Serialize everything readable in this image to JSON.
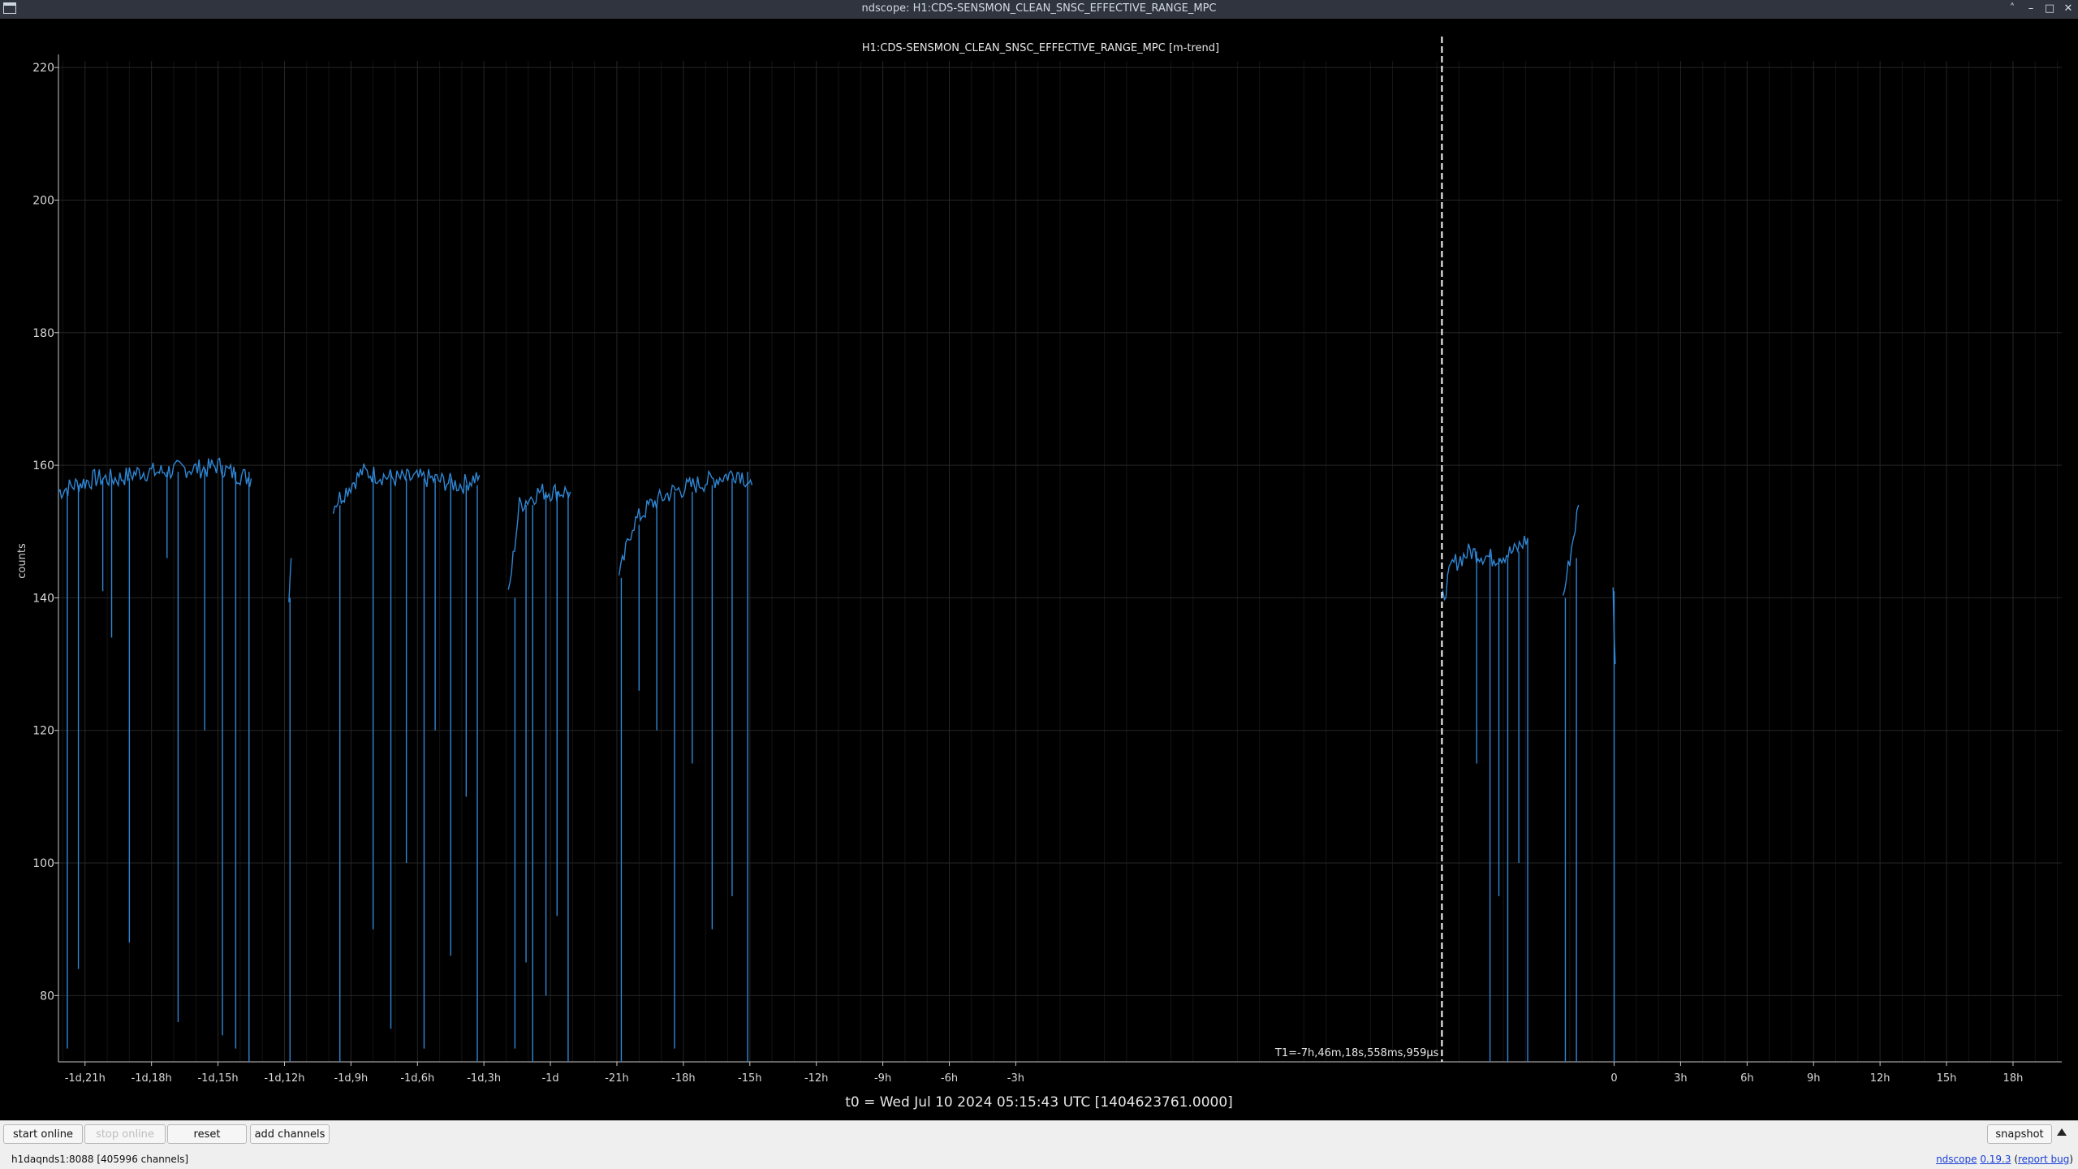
{
  "window": {
    "title": "ndscope: H1:CDS-SENSMON_CLEAN_SNSC_EFFECTIVE_RANGE_MPC",
    "controls": [
      "˄",
      "–",
      "□",
      "✕"
    ]
  },
  "plot": {
    "title": "H1:CDS-SENSMON_CLEAN_SNSC_EFFECTIVE_RANGE_MPC [m-trend]",
    "ylabel": "counts",
    "cursor_label": "T1=-7h,46m,18s,558ms,959μs",
    "t0_label": "t0 = Wed Jul 10 2024 05:15:43 UTC [1404623761.0000]"
  },
  "chart_data": {
    "type": "line",
    "title": "H1:CDS-SENSMON_CLEAN_SNSC_EFFECTIVE_RANGE_MPC [m-trend]",
    "xlabel": "t0 = Wed Jul 10 2024 05:15:43 UTC [1404623761.0000]",
    "ylabel": "counts",
    "xlim": [
      -70.2,
      20.2
    ],
    "ylim": [
      70,
      221
    ],
    "y_ticks": [
      80,
      100,
      120,
      140,
      160,
      180,
      200,
      220
    ],
    "x_ticks": [
      {
        "v": -69,
        "label": "-1d,21h"
      },
      {
        "v": -66,
        "label": "-1d,18h"
      },
      {
        "v": -63,
        "label": "-1d,15h"
      },
      {
        "v": -60,
        "label": "-1d,12h"
      },
      {
        "v": -57,
        "label": "-1d,9h"
      },
      {
        "v": -54,
        "label": "-1d,6h"
      },
      {
        "v": -51,
        "label": "-1d,3h"
      },
      {
        "v": -48,
        "label": "-1d"
      },
      {
        "v": -45,
        "label": "-21h"
      },
      {
        "v": -42,
        "label": "-18h"
      },
      {
        "v": -39,
        "label": "-15h"
      },
      {
        "v": -36,
        "label": "-12h"
      },
      {
        "v": -33,
        "label": "-9h"
      },
      {
        "v": -30,
        "label": "-6h"
      },
      {
        "v": -27,
        "label": "-3h"
      },
      {
        "v": 0,
        "label": "0"
      },
      {
        "v": 3,
        "label": "3h"
      },
      {
        "v": 6,
        "label": "6h"
      },
      {
        "v": 9,
        "label": "9h"
      },
      {
        "v": 12,
        "label": "12h"
      },
      {
        "v": 15,
        "label": "15h"
      },
      {
        "v": 18,
        "label": "18h"
      }
    ],
    "grid": true,
    "cursor_x": -7.77,
    "line_color": "#2f86d4",
    "series": [
      {
        "segments": [
          {
            "x": [
              -70.2,
              -69.5,
              -68.5,
              -67.5,
              -66.5,
              -65.5,
              -64.5,
              -63.5,
              -63,
              -62.5,
              -61.5
            ],
            "y": [
              156,
              157,
              158,
              158,
              159,
              159,
              159.5,
              159.5,
              160,
              159,
              158
            ],
            "dips": [
              [
                -69.8,
                72
              ],
              [
                -69.3,
                84
              ],
              [
                -68.2,
                141
              ],
              [
                -67.8,
                134
              ],
              [
                -67,
                88
              ],
              [
                -65.3,
                146
              ],
              [
                -64.8,
                76
              ],
              [
                -63.6,
                120
              ],
              [
                -62.8,
                74
              ],
              [
                -62.2,
                72
              ],
              [
                -61.6,
                70
              ]
            ]
          },
          {
            "x": [
              -59.8,
              -59.7
            ],
            "y": [
              140,
              146
            ],
            "dips": [
              [
                -59.75,
                70
              ]
            ]
          },
          {
            "x": [
              -57.8,
              -56.5,
              -55,
              -53.5,
              -52,
              -51.2
            ],
            "y": [
              154,
              159,
              158,
              158,
              157,
              158.5
            ],
            "dips": [
              [
                -57.5,
                70
              ],
              [
                -56,
                90
              ],
              [
                -55.2,
                75
              ],
              [
                -54.5,
                100
              ],
              [
                -53.7,
                72
              ],
              [
                -53.2,
                120
              ],
              [
                -52.5,
                86
              ],
              [
                -51.8,
                110
              ],
              [
                -51.3,
                70
              ]
            ]
          },
          {
            "x": [
              -49.9,
              -49.4,
              -48.5,
              -47.5,
              -47.1
            ],
            "y": [
              140,
              154,
              156,
              156,
              156
            ],
            "dips": [
              [
                -49.6,
                72
              ],
              [
                -49.1,
                85
              ],
              [
                -48.8,
                70
              ],
              [
                -48.2,
                80
              ],
              [
                -47.7,
                92
              ],
              [
                -47.2,
                70
              ]
            ]
          },
          {
            "x": [
              -44.9,
              -44.3,
              -43.5,
              -42.5,
              -41.5,
              -40.5,
              -39.5,
              -38.9
            ],
            "y": [
              143,
              151,
              154,
              156,
              157,
              158,
              159,
              157
            ],
            "dips": [
              [
                -44.8,
                70
              ],
              [
                -44,
                126
              ],
              [
                -43.2,
                120
              ],
              [
                -42.4,
                72
              ],
              [
                -41.6,
                115
              ],
              [
                -40.7,
                90
              ],
              [
                -39.8,
                95
              ],
              [
                -39.1,
                70
              ]
            ]
          },
          {
            "x": [
              -7.8,
              -7.3,
              -6.5,
              -5.5,
              -4.5,
              -3.9
            ],
            "y": [
              139,
              145,
              147,
              146,
              147,
              149
            ],
            "dips": [
              [
                -6.2,
                115
              ],
              [
                -5.6,
                70
              ],
              [
                -5.2,
                95
              ],
              [
                -4.8,
                70
              ],
              [
                -4.3,
                100
              ],
              [
                -3.9,
                70
              ]
            ]
          },
          {
            "x": [
              -2.3,
              -2.0,
              -1.6
            ],
            "y": [
              140,
              146,
              154
            ],
            "dips": [
              [
                -2.2,
                70
              ],
              [
                -1.7,
                70
              ]
            ]
          },
          {
            "x": [
              -0.05,
              0.05
            ],
            "y": [
              141,
              130
            ],
            "dips": [
              [
                0,
                70
              ]
            ]
          }
        ]
      }
    ]
  },
  "toolbar": {
    "start_online": "start online",
    "stop_online": "stop online",
    "reset": "reset",
    "add_channels": "add channels",
    "snapshot": "snapshot"
  },
  "status": {
    "server": "h1daqnds1:8088  [405996 channels]",
    "version_link": "ndscope",
    "version_number": "0.19.3",
    "report_bug": "report bug"
  }
}
